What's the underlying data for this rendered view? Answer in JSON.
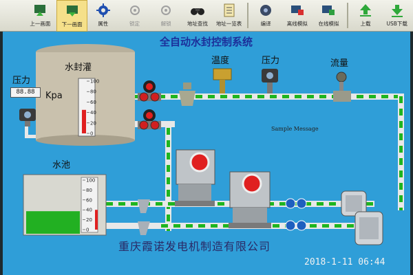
{
  "toolbar": {
    "buttons": [
      {
        "label": "上一画面",
        "icon": "prev-screen-icon"
      },
      {
        "label": "下一画面",
        "icon": "next-screen-icon"
      },
      {
        "label": "属性",
        "icon": "gear-icon"
      },
      {
        "label": "锁定",
        "icon": "lock-icon"
      },
      {
        "label": "解锁",
        "icon": "unlock-icon"
      },
      {
        "label": "地址查找",
        "icon": "binoculars-icon"
      },
      {
        "label": "地址一览表",
        "icon": "address-list-icon"
      },
      {
        "label": "编译",
        "icon": "compile-icon"
      },
      {
        "label": "离线模拟",
        "icon": "offline-sim-icon"
      },
      {
        "label": "在线模拟",
        "icon": "online-sim-icon"
      },
      {
        "label": "上载",
        "icon": "upload-icon"
      },
      {
        "label": "USB下载",
        "icon": "usb-download-icon"
      }
    ]
  },
  "screen": {
    "title": "全自动水封控制系统",
    "tank_label": "水封灌",
    "pressure_label": "压力",
    "pressure_value": "88.88",
    "pressure_unit": "Kpa",
    "temperature_label": "温度",
    "pressure_top_label": "压力",
    "flow_label": "流量",
    "pool_label": "水池",
    "message": "Sample Message",
    "company": "重庆霞诺发电机制造有限公司",
    "scale_ticks": [
      "100",
      "80",
      "60",
      "40",
      "20",
      "0"
    ],
    "tank_level": 0.45,
    "pool_level": 0.4
  },
  "photo_timestamp": "2018-1-11 06:44",
  "colors": {
    "background": "#2f9ed8",
    "pipe": "#e8e8e8",
    "pipe_dash": "#1fb51f",
    "water": "#22b022",
    "indicator_red": "#e02020",
    "title": "#1c2f9a"
  }
}
